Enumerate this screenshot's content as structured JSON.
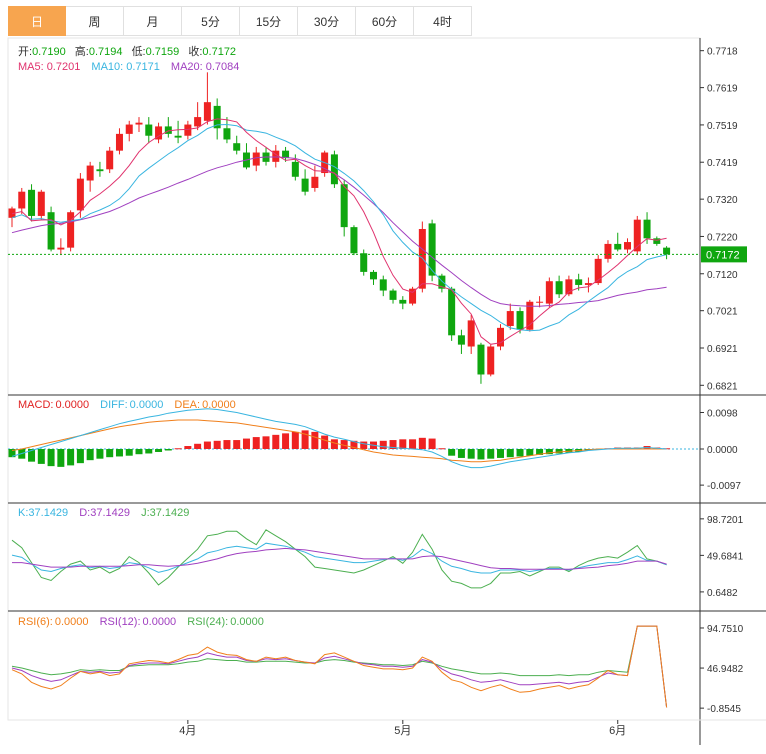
{
  "tabs": [
    {
      "label": "日",
      "active": true
    },
    {
      "label": "周",
      "active": false
    },
    {
      "label": "月",
      "active": false
    },
    {
      "label": "5分",
      "active": false
    },
    {
      "label": "15分",
      "active": false
    },
    {
      "label": "30分",
      "active": false
    },
    {
      "label": "60分",
      "active": false
    },
    {
      "label": "4时",
      "active": false
    }
  ],
  "ohlc_info": {
    "open_label": "开:",
    "open": "0.7190",
    "high_label": "高:",
    "high": "0.7194",
    "low_label": "低:",
    "low": "0.7159",
    "close_label": "收:",
    "close": "0.7172"
  },
  "ma_info": {
    "ma5_label": "MA5:",
    "ma5": "0.7201",
    "ma10_label": "MA10:",
    "ma10": "0.7171",
    "ma20_label": "MA20:",
    "ma20": "0.7084"
  },
  "macd_info": {
    "macd_label": "MACD:",
    "macd": "0.0000",
    "diff_label": "DIFF:",
    "diff": "0.0000",
    "dea_label": "DEA:",
    "dea": "0.0000"
  },
  "kdj_info": {
    "k_label": "K:",
    "k": "37.1429",
    "d_label": "D:",
    "d": "37.1429",
    "j_label": "J:",
    "j": "37.1429"
  },
  "rsi_info": {
    "rsi6_label": "RSI(6):",
    "rsi6": "0.0000",
    "rsi12_label": "RSI(12):",
    "rsi12": "0.0000",
    "rsi24_label": "RSI(24):",
    "rsi24": "0.0000"
  },
  "colors": {
    "up": "#ee2222",
    "down": "#0fa60f",
    "ma5": "#e0336e",
    "ma10": "#39b5e0",
    "ma20": "#a040c0",
    "diff": "#39b5e0",
    "dea": "#f07f1b",
    "k": "#39b5e0",
    "d": "#a040c0",
    "j": "#4caf50",
    "rsi6": "#f07f1b",
    "rsi12": "#a040c0",
    "rsi24": "#4caf50",
    "current": "#0fa60f"
  },
  "chart_data": {
    "type": "candlestick",
    "current_price": "0.7172",
    "x_ticks": [
      "4月",
      "5月",
      "6月"
    ],
    "price_axis": {
      "ticks": [
        "0.7718",
        "0.7619",
        "0.7519",
        "0.7419",
        "0.7320",
        "0.7220",
        "0.7120",
        "0.7021",
        "0.6921",
        "0.6821"
      ],
      "ylim": [
        0.6795,
        0.7752
      ]
    },
    "macd_axis": {
      "ticks": [
        "0.0098",
        "0.0000",
        "-0.0097"
      ],
      "ylim": [
        -0.0145,
        0.0145
      ]
    },
    "kdj_axis": {
      "ticks": [
        "98.7201",
        "49.6841",
        "0.6482"
      ],
      "ylim": [
        -25,
        120
      ]
    },
    "rsi_axis": {
      "ticks": [
        "94.7510",
        "46.9482",
        "-0.8545"
      ],
      "ylim": [
        -15,
        115
      ]
    },
    "candles": [
      {
        "o": 0.727,
        "h": 0.73,
        "l": 0.7245,
        "c": 0.7295
      },
      {
        "o": 0.7295,
        "h": 0.735,
        "l": 0.728,
        "c": 0.734
      },
      {
        "o": 0.7345,
        "h": 0.736,
        "l": 0.726,
        "c": 0.7275
      },
      {
        "o": 0.7275,
        "h": 0.7345,
        "l": 0.7265,
        "c": 0.734
      },
      {
        "o": 0.7285,
        "h": 0.73,
        "l": 0.718,
        "c": 0.7185
      },
      {
        "o": 0.7185,
        "h": 0.7215,
        "l": 0.717,
        "c": 0.719
      },
      {
        "o": 0.719,
        "h": 0.729,
        "l": 0.718,
        "c": 0.7285
      },
      {
        "o": 0.729,
        "h": 0.739,
        "l": 0.727,
        "c": 0.7375
      },
      {
        "o": 0.737,
        "h": 0.742,
        "l": 0.734,
        "c": 0.741
      },
      {
        "o": 0.74,
        "h": 0.742,
        "l": 0.738,
        "c": 0.7395
      },
      {
        "o": 0.74,
        "h": 0.746,
        "l": 0.739,
        "c": 0.745
      },
      {
        "o": 0.745,
        "h": 0.751,
        "l": 0.744,
        "c": 0.7495
      },
      {
        "o": 0.7495,
        "h": 0.753,
        "l": 0.7475,
        "c": 0.752
      },
      {
        "o": 0.752,
        "h": 0.754,
        "l": 0.75,
        "c": 0.7525
      },
      {
        "o": 0.752,
        "h": 0.754,
        "l": 0.747,
        "c": 0.749
      },
      {
        "o": 0.748,
        "h": 0.7525,
        "l": 0.747,
        "c": 0.7515
      },
      {
        "o": 0.7515,
        "h": 0.754,
        "l": 0.7485,
        "c": 0.7495
      },
      {
        "o": 0.749,
        "h": 0.753,
        "l": 0.747,
        "c": 0.7485
      },
      {
        "o": 0.749,
        "h": 0.753,
        "l": 0.748,
        "c": 0.752
      },
      {
        "o": 0.7515,
        "h": 0.758,
        "l": 0.7505,
        "c": 0.754
      },
      {
        "o": 0.753,
        "h": 0.766,
        "l": 0.752,
        "c": 0.758
      },
      {
        "o": 0.757,
        "h": 0.759,
        "l": 0.748,
        "c": 0.751
      },
      {
        "o": 0.751,
        "h": 0.754,
        "l": 0.747,
        "c": 0.748
      },
      {
        "o": 0.747,
        "h": 0.749,
        "l": 0.744,
        "c": 0.745
      },
      {
        "o": 0.7445,
        "h": 0.747,
        "l": 0.74,
        "c": 0.7405
      },
      {
        "o": 0.741,
        "h": 0.746,
        "l": 0.7395,
        "c": 0.7445
      },
      {
        "o": 0.7445,
        "h": 0.746,
        "l": 0.741,
        "c": 0.742
      },
      {
        "o": 0.742,
        "h": 0.7465,
        "l": 0.7405,
        "c": 0.745
      },
      {
        "o": 0.745,
        "h": 0.746,
        "l": 0.742,
        "c": 0.743
      },
      {
        "o": 0.742,
        "h": 0.744,
        "l": 0.737,
        "c": 0.738
      },
      {
        "o": 0.7375,
        "h": 0.74,
        "l": 0.733,
        "c": 0.734
      },
      {
        "o": 0.735,
        "h": 0.741,
        "l": 0.734,
        "c": 0.738
      },
      {
        "o": 0.739,
        "h": 0.745,
        "l": 0.738,
        "c": 0.7445
      },
      {
        "o": 0.744,
        "h": 0.745,
        "l": 0.735,
        "c": 0.736
      },
      {
        "o": 0.736,
        "h": 0.737,
        "l": 0.722,
        "c": 0.7245
      },
      {
        "o": 0.7245,
        "h": 0.725,
        "l": 0.717,
        "c": 0.7175
      },
      {
        "o": 0.7175,
        "h": 0.7185,
        "l": 0.7115,
        "c": 0.7125
      },
      {
        "o": 0.7125,
        "h": 0.713,
        "l": 0.709,
        "c": 0.7105
      },
      {
        "o": 0.7105,
        "h": 0.7115,
        "l": 0.706,
        "c": 0.7075
      },
      {
        "o": 0.7075,
        "h": 0.708,
        "l": 0.704,
        "c": 0.705
      },
      {
        "o": 0.705,
        "h": 0.706,
        "l": 0.7025,
        "c": 0.704
      },
      {
        "o": 0.704,
        "h": 0.7085,
        "l": 0.7035,
        "c": 0.708
      },
      {
        "o": 0.708,
        "h": 0.726,
        "l": 0.707,
        "c": 0.724
      },
      {
        "o": 0.7255,
        "h": 0.7265,
        "l": 0.71,
        "c": 0.7115
      },
      {
        "o": 0.7115,
        "h": 0.712,
        "l": 0.707,
        "c": 0.708
      },
      {
        "o": 0.708,
        "h": 0.7085,
        "l": 0.694,
        "c": 0.6955
      },
      {
        "o": 0.6955,
        "h": 0.697,
        "l": 0.6905,
        "c": 0.693
      },
      {
        "o": 0.6925,
        "h": 0.701,
        "l": 0.6905,
        "c": 0.6995
      },
      {
        "o": 0.693,
        "h": 0.6935,
        "l": 0.6825,
        "c": 0.685
      },
      {
        "o": 0.685,
        "h": 0.693,
        "l": 0.6845,
        "c": 0.6925
      },
      {
        "o": 0.6925,
        "h": 0.6985,
        "l": 0.6915,
        "c": 0.6975
      },
      {
        "o": 0.698,
        "h": 0.704,
        "l": 0.697,
        "c": 0.702
      },
      {
        "o": 0.702,
        "h": 0.703,
        "l": 0.696,
        "c": 0.697
      },
      {
        "o": 0.697,
        "h": 0.705,
        "l": 0.6965,
        "c": 0.7045
      },
      {
        "o": 0.7045,
        "h": 0.706,
        "l": 0.703,
        "c": 0.7045
      },
      {
        "o": 0.704,
        "h": 0.711,
        "l": 0.703,
        "c": 0.71
      },
      {
        "o": 0.71,
        "h": 0.7115,
        "l": 0.7055,
        "c": 0.7065
      },
      {
        "o": 0.7065,
        "h": 0.7115,
        "l": 0.706,
        "c": 0.7105
      },
      {
        "o": 0.7105,
        "h": 0.712,
        "l": 0.7075,
        "c": 0.709
      },
      {
        "o": 0.709,
        "h": 0.711,
        "l": 0.707,
        "c": 0.7095
      },
      {
        "o": 0.7095,
        "h": 0.717,
        "l": 0.709,
        "c": 0.716
      },
      {
        "o": 0.716,
        "h": 0.721,
        "l": 0.715,
        "c": 0.72
      },
      {
        "o": 0.72,
        "h": 0.723,
        "l": 0.718,
        "c": 0.7185
      },
      {
        "o": 0.7185,
        "h": 0.7215,
        "l": 0.7175,
        "c": 0.7205
      },
      {
        "o": 0.718,
        "h": 0.7275,
        "l": 0.717,
        "c": 0.7265
      },
      {
        "o": 0.7265,
        "h": 0.7285,
        "l": 0.72,
        "c": 0.7215
      },
      {
        "o": 0.7215,
        "h": 0.722,
        "l": 0.7195,
        "c": 0.72
      },
      {
        "o": 0.719,
        "h": 0.7194,
        "l": 0.7159,
        "c": 0.7172
      }
    ],
    "ma5": [
      0.7281,
      0.7287,
      0.7262,
      0.7264,
      0.7265,
      0.7251,
      0.7263,
      0.7286,
      0.7317,
      0.7334,
      0.7355,
      0.7379,
      0.741,
      0.7447,
      0.7472,
      0.7489,
      0.7503,
      0.7506,
      0.7507,
      0.7511,
      0.7528,
      0.7535,
      0.7533,
      0.7527,
      0.7499,
      0.7477,
      0.7459,
      0.744,
      0.7424,
      0.7427,
      0.741,
      0.7396,
      0.7395,
      0.739,
      0.7354,
      0.7329,
      0.7286,
      0.7231,
      0.7166,
      0.7116,
      0.7079,
      0.707,
      0.7093,
      0.7093,
      0.7085,
      0.7077,
      0.7041,
      0.7012,
      0.6951,
      0.6931,
      0.6935,
      0.6952,
      0.6968,
      0.6983,
      0.7007,
      0.7029,
      0.7044,
      0.7072,
      0.7082,
      0.7085,
      0.7103,
      0.7123,
      0.7144,
      0.7169,
      0.7193,
      0.7214,
      0.721,
      0.7215
    ],
    "ma10": [
      0.727,
      0.7278,
      0.7266,
      0.7268,
      0.7262,
      0.7258,
      0.7262,
      0.7266,
      0.7281,
      0.7291,
      0.7303,
      0.7321,
      0.7348,
      0.7382,
      0.7403,
      0.7422,
      0.7441,
      0.7458,
      0.7477,
      0.7491,
      0.7509,
      0.7519,
      0.752,
      0.7517,
      0.7505,
      0.7502,
      0.7497,
      0.7486,
      0.7476,
      0.7463,
      0.7444,
      0.7427,
      0.7418,
      0.7407,
      0.7389,
      0.7369,
      0.7343,
      0.7313,
      0.7278,
      0.7235,
      0.7204,
      0.7178,
      0.7162,
      0.7129,
      0.71,
      0.7078,
      0.7058,
      0.704,
      0.7022,
      0.7008,
      0.699,
      0.6975,
      0.697,
      0.6967,
      0.6969,
      0.698,
      0.6989,
      0.701,
      0.7025,
      0.7046,
      0.7065,
      0.7083,
      0.7108,
      0.7126,
      0.7139,
      0.7158,
      0.7165,
      0.7171
    ],
    "ma20": [
      0.723,
      0.7237,
      0.7243,
      0.7249,
      0.7253,
      0.7255,
      0.7259,
      0.7265,
      0.7271,
      0.7279,
      0.7287,
      0.7298,
      0.731,
      0.7323,
      0.7333,
      0.7342,
      0.7352,
      0.7363,
      0.7373,
      0.7384,
      0.7395,
      0.7404,
      0.7411,
      0.7419,
      0.7425,
      0.7431,
      0.7433,
      0.7433,
      0.7432,
      0.7429,
      0.7422,
      0.7413,
      0.7402,
      0.7389,
      0.7372,
      0.7352,
      0.7331,
      0.7308,
      0.7284,
      0.7257,
      0.7232,
      0.7207,
      0.7186,
      0.7164,
      0.7143,
      0.7123,
      0.7102,
      0.7083,
      0.7065,
      0.7049,
      0.704,
      0.7036,
      0.7034,
      0.7033,
      0.7033,
      0.7035,
      0.7038,
      0.704,
      0.7043,
      0.7045,
      0.7048,
      0.7055,
      0.7062,
      0.7067,
      0.7071,
      0.7077,
      0.708,
      0.7084
    ],
    "macd_hist": [
      -0.0022,
      -0.0026,
      -0.0034,
      -0.004,
      -0.0046,
      -0.0048,
      -0.0044,
      -0.0038,
      -0.003,
      -0.0026,
      -0.0022,
      -0.002,
      -0.0018,
      -0.0014,
      -0.0012,
      -0.0008,
      -0.0004,
      0.0002,
      0.0008,
      0.0014,
      0.002,
      0.0022,
      0.0024,
      0.0024,
      0.0028,
      0.0032,
      0.0034,
      0.0038,
      0.0042,
      0.0046,
      0.005,
      0.0046,
      0.0036,
      0.0026,
      0.0024,
      0.0022,
      0.002,
      0.002,
      0.0022,
      0.0024,
      0.0026,
      0.0026,
      0.003,
      0.0028,
      0.0002,
      -0.0018,
      -0.0024,
      -0.0026,
      -0.0028,
      -0.0026,
      -0.0024,
      -0.0022,
      -0.002,
      -0.0018,
      -0.0016,
      -0.0014,
      -0.0012,
      -0.001,
      -0.0008,
      -0.0004,
      0.0,
      0.0002,
      0.0004,
      0.0004,
      0.0004,
      0.0008,
      0.0004,
      0.0002
    ],
    "macd_diff": [
      -0.002,
      -0.0012,
      -0.0004,
      0.0004,
      0.0012,
      0.002,
      0.0028,
      0.0036,
      0.0044,
      0.0052,
      0.006,
      0.0068,
      0.0074,
      0.008,
      0.0086,
      0.009,
      0.0096,
      0.01,
      0.0104,
      0.0106,
      0.0108,
      0.0106,
      0.0102,
      0.0098,
      0.0092,
      0.0086,
      0.008,
      0.0074,
      0.007,
      0.0066,
      0.006,
      0.005,
      0.004,
      0.0032,
      0.0026,
      0.002,
      0.0014,
      0.001,
      0.0006,
      0.0004,
      0.0002,
      0.0,
      -0.0002,
      -0.0008,
      -0.002,
      -0.0034,
      -0.0044,
      -0.005,
      -0.005,
      -0.0046,
      -0.004,
      -0.0034,
      -0.003,
      -0.0026,
      -0.0022,
      -0.0018,
      -0.0014,
      -0.001,
      -0.0008,
      -0.0004,
      -0.0002,
      0.0,
      0.0002,
      0.0002,
      0.0002,
      0.0004,
      0.0002,
      0.0
    ],
    "macd_dea": [
      -0.0004,
      0.0,
      0.0006,
      0.0012,
      0.0018,
      0.0024,
      0.003,
      0.0036,
      0.0042,
      0.0048,
      0.0054,
      0.006,
      0.0064,
      0.0068,
      0.0072,
      0.0074,
      0.0076,
      0.0078,
      0.0078,
      0.0078,
      0.0076,
      0.0074,
      0.0072,
      0.007,
      0.0066,
      0.0062,
      0.0058,
      0.0054,
      0.005,
      0.0046,
      0.004,
      0.0032,
      0.0024,
      0.0016,
      0.001,
      0.0004,
      -0.0002,
      -0.0008,
      -0.0012,
      -0.0016,
      -0.0018,
      -0.002,
      -0.0022,
      -0.0024,
      -0.0026,
      -0.003,
      -0.0032,
      -0.0034,
      -0.0034,
      -0.0032,
      -0.003,
      -0.0026,
      -0.0022,
      -0.0018,
      -0.0014,
      -0.001,
      -0.0008,
      -0.0006,
      -0.0004,
      -0.0002,
      0.0,
      0.0,
      0.0,
      0.0,
      0.0,
      0.0,
      0.0,
      0.0
    ],
    "kdj_k": [
      50,
      47,
      38,
      30,
      28,
      32,
      35,
      37,
      33,
      35,
      32,
      34,
      40,
      38,
      33,
      27,
      30,
      35,
      40,
      45,
      53,
      56,
      60,
      62,
      60,
      58,
      66,
      64,
      62,
      58,
      54,
      48,
      46,
      44,
      42,
      40,
      40,
      42,
      44,
      46,
      43,
      48,
      58,
      52,
      42,
      35,
      32,
      28,
      26,
      26,
      30,
      30,
      30,
      28,
      30,
      32,
      32,
      30,
      33,
      36,
      38,
      40,
      40,
      44,
      49,
      43,
      42,
      37
    ],
    "kdj_d": [
      40,
      40,
      38,
      36,
      34,
      34,
      34,
      35,
      35,
      35,
      35,
      35,
      36,
      37,
      37,
      36,
      35,
      36,
      37,
      39,
      42,
      45,
      49,
      52,
      54,
      55,
      57,
      58,
      59,
      58,
      57,
      55,
      53,
      51,
      49,
      47,
      45,
      45,
      45,
      45,
      45,
      45,
      48,
      49,
      48,
      45,
      42,
      39,
      36,
      33,
      32,
      32,
      31,
      31,
      31,
      31,
      31,
      31,
      32,
      33,
      34,
      36,
      37,
      39,
      42,
      42,
      42,
      38
    ],
    "kdj_j": [
      70,
      60,
      40,
      20,
      16,
      28,
      38,
      42,
      30,
      34,
      26,
      32,
      48,
      40,
      26,
      10,
      20,
      34,
      46,
      58,
      76,
      78,
      82,
      82,
      72,
      64,
      84,
      76,
      68,
      58,
      48,
      34,
      32,
      30,
      28,
      26,
      30,
      36,
      42,
      48,
      39,
      54,
      78,
      58,
      30,
      15,
      12,
      6,
      6,
      12,
      26,
      26,
      28,
      22,
      28,
      34,
      34,
      28,
      36,
      42,
      46,
      48,
      46,
      54,
      63,
      45,
      42,
      37
    ],
    "rsi6": [
      45,
      40,
      30,
      25,
      22,
      26,
      35,
      43,
      40,
      42,
      38,
      40,
      52,
      54,
      56,
      55,
      53,
      57,
      62,
      64,
      72,
      66,
      63,
      62,
      57,
      55,
      60,
      58,
      60,
      56,
      54,
      52,
      63,
      65,
      60,
      55,
      50,
      48,
      46,
      46,
      45,
      47,
      60,
      55,
      42,
      33,
      30,
      24,
      20,
      24,
      27,
      22,
      18,
      19,
      22,
      24,
      26,
      22,
      25,
      27,
      35,
      44,
      39,
      38,
      97,
      97,
      97,
      0
    ],
    "rsi12": [
      47,
      44,
      38,
      34,
      31,
      33,
      38,
      43,
      42,
      43,
      41,
      42,
      50,
      52,
      53,
      53,
      52,
      55,
      58,
      60,
      65,
      62,
      60,
      60,
      56,
      55,
      58,
      57,
      58,
      56,
      54,
      53,
      59,
      61,
      58,
      55,
      52,
      51,
      49,
      49,
      48,
      49,
      57,
      54,
      46,
      40,
      37,
      33,
      30,
      31,
      33,
      30,
      27,
      27,
      28,
      29,
      30,
      28,
      30,
      31,
      36,
      41,
      39,
      38,
      97,
      97,
      97,
      0
    ],
    "rsi24": [
      49,
      47,
      44,
      41,
      39,
      40,
      42,
      45,
      44,
      45,
      44,
      44,
      49,
      50,
      51,
      51,
      51,
      52,
      54,
      55,
      58,
      57,
      56,
      56,
      54,
      54,
      55,
      55,
      55,
      54,
      53,
      53,
      56,
      57,
      56,
      54,
      53,
      52,
      51,
      51,
      50,
      51,
      55,
      53,
      49,
      46,
      44,
      42,
      40,
      40,
      41,
      40,
      38,
      38,
      38,
      38,
      39,
      38,
      39,
      39,
      42,
      44,
      43,
      42,
      97,
      97,
      97,
      0
    ]
  }
}
